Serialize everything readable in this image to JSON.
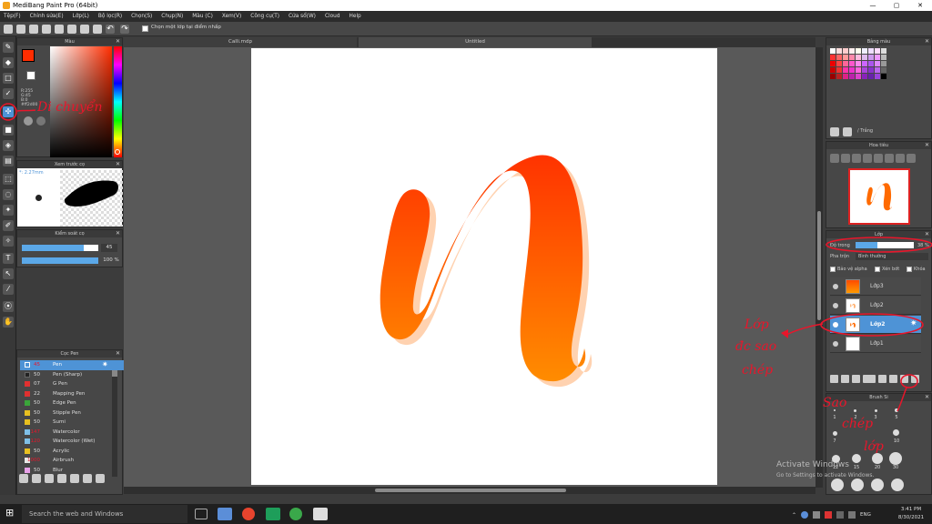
{
  "window": {
    "title": "MediBang Paint Pro (64bit)",
    "minimize": "—",
    "maximize": "▢",
    "close": "✕"
  },
  "menu": [
    "Tệp(F)",
    "Chỉnh sửa(E)",
    "Lớp(L)",
    "Bộ lọc(R)",
    "Chọn(S)",
    "Chụp(N)",
    "Màu (C)",
    "Xem(V)",
    "Công cụ(T)",
    "Cửa sổ(W)",
    "Cloud",
    "Help"
  ],
  "toolbar": {
    "snap_label": "Chọn một lớp tại điểm nhấp"
  },
  "tabs": [
    {
      "label": "Calli.mdp"
    },
    {
      "label": "Untitled"
    }
  ],
  "color_panel": {
    "title": "Màu",
    "r": "R:255",
    "g": "G:45",
    "b": "B:0",
    "hex": "#ff2d00",
    "foreground": "#ff2d00",
    "background": "#ffffff"
  },
  "brush_preview": {
    "title": "Xem trước cọ",
    "size": "*: 2.27mm"
  },
  "brush_control": {
    "title": "Kiểm soát cọ",
    "size_value": "45",
    "opacity_value": "100 %"
  },
  "brush_list": {
    "title": "Cọc Pen",
    "items": [
      {
        "size": "45",
        "color": "#4e93d6",
        "name": "Pen",
        "selected": true
      },
      {
        "size": "50",
        "color": "#222222",
        "name": "Pen (Sharp)"
      },
      {
        "size": "07",
        "color": "#e03030",
        "name": "G Pen"
      },
      {
        "size": "22",
        "color": "#e03030",
        "name": "Mapping Pen"
      },
      {
        "size": "50",
        "color": "#3aa63a",
        "name": "Edge Pen"
      },
      {
        "size": "50",
        "color": "#e8c020",
        "name": "Stipple Pen"
      },
      {
        "size": "50",
        "color": "#e8c020",
        "name": "Sumi"
      },
      {
        "size": "147",
        "color": "#7fc0e8",
        "name": "Watercolor"
      },
      {
        "size": "120",
        "color": "#7fc0e8",
        "name": "Watercolor (Wet)"
      },
      {
        "size": "50",
        "color": "#e8c020",
        "name": "Acrylic"
      },
      {
        "size": "1000",
        "color": "#e8e8e8",
        "name": "Airbrush"
      },
      {
        "size": "50",
        "color": "#e8a0e8",
        "name": "Blur"
      }
    ]
  },
  "palette_panel": {
    "title": "Bảng màu",
    "swatch_name": "/ Trắng"
  },
  "navigator": {
    "title": "Hoa tiêu"
  },
  "layers_panel": {
    "title": "Lớp",
    "opacity_label": "Độ trong",
    "opacity_value": "38 %",
    "opacity_fraction": 0.38,
    "blend_label": "Pha trộn",
    "blend_value": "Bình thường",
    "protect_alpha": "Bảo vệ alpha",
    "clipping": "Xén bớt",
    "lock": "Khóa",
    "layers": [
      {
        "name": "Lớp3"
      },
      {
        "name": "Lớp2"
      },
      {
        "name": "Lớp2",
        "selected": true
      },
      {
        "name": "Lớp1"
      }
    ]
  },
  "brush_size_panel": {
    "title": "Brush Si",
    "labels": [
      "1",
      "2",
      "3",
      "5",
      "7",
      "10",
      "12",
      "15",
      "20",
      "30"
    ]
  },
  "annotations": {
    "move_tool": "Di chuyển",
    "copied_layer_1": "Lớp",
    "copied_layer_2": "đc sao",
    "copied_layer_3": "chép",
    "duplicate_1": "Sao",
    "duplicate_2": "chép",
    "duplicate_3": "lớp"
  },
  "watermark": {
    "line1": "Activate Windows",
    "line2": "Go to Settings to activate Windows."
  },
  "taskbar": {
    "search_placeholder": "Search the web and Windows",
    "lang": "ENG",
    "time": "3:41 PM",
    "date": "8/30/2021"
  }
}
